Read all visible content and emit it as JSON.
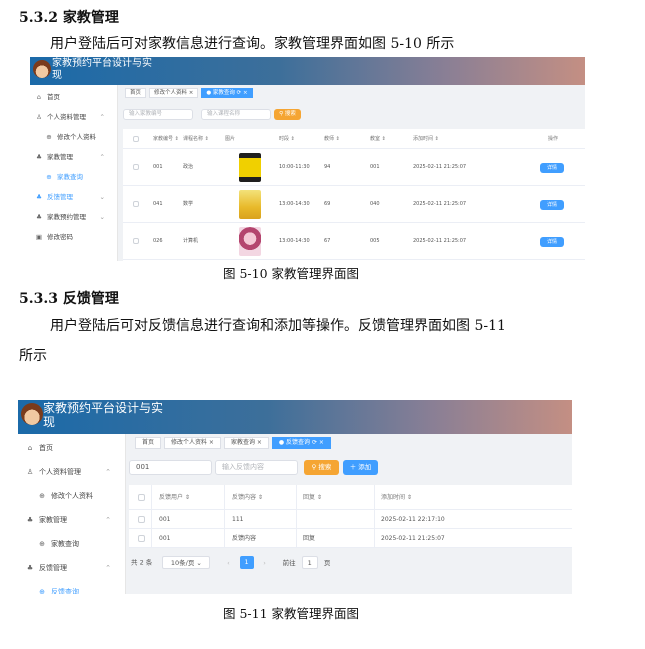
{
  "section_532": {
    "heading": "5.3.2 家教管理",
    "paragraph": "用户登陆后可对家教信息进行查询。家教管理界面如图 5-10 所示",
    "caption": "图 5-10 家教管理界面图"
  },
  "section_533": {
    "heading": "5.3.3 反馈管理",
    "paragraph_line1": "用户登陆后可对反馈信息进行查询和添加等操作。反馈管理界面如图 5-11",
    "paragraph_line2": "所示",
    "caption": "图 5-11 家教管理界面图"
  },
  "app_title_line1": "家教预约平台设计与实",
  "app_title_line2": "现",
  "figure1": {
    "sidebar": [
      {
        "icon": "⌂",
        "label": "首页"
      },
      {
        "icon": "♙",
        "label": "个人资料管理",
        "chevron": "⌃"
      },
      {
        "icon": "⊕",
        "label": "修改个人资料",
        "sub": true
      },
      {
        "icon": "♣",
        "label": "家教管理",
        "chevron": "⌃"
      },
      {
        "icon": "⊕",
        "label": "家教查询",
        "sub": true,
        "active": true
      },
      {
        "icon": "♣",
        "label": "反馈管理",
        "chevron": "⌄",
        "active": true
      },
      {
        "icon": "♣",
        "label": "家教预约管理",
        "chevron": "⌄"
      },
      {
        "icon": "▣",
        "label": "修改密码"
      }
    ],
    "tabs": [
      {
        "label": "首页"
      },
      {
        "label": "修改个人资料 ×"
      },
      {
        "label": "● 家教查询 ⟳ ×",
        "active": true
      }
    ],
    "search_placeholder_1": "输入家教编号",
    "search_placeholder_2": "输入课程名称",
    "search_button": "⚲ 搜索",
    "columns": [
      "家教编号 ⇕",
      "课程名称 ⇕",
      "图片",
      "时段 ⇕",
      "教师 ⇕",
      "教室 ⇕",
      "添加时间 ⇕",
      "操作"
    ],
    "rows": [
      {
        "id": "001",
        "course": "政治",
        "time": "10:00-11:30",
        "teacher": "94",
        "room": "001",
        "added": "2025-02-11 21:25:07",
        "action": "详情"
      },
      {
        "id": "041",
        "course": "数学",
        "time": "13:00-14:30",
        "teacher": "69",
        "room": "040",
        "added": "2025-02-11 21:25:07",
        "action": "详情"
      },
      {
        "id": "026",
        "course": "计算机",
        "time": "13:00-14:30",
        "teacher": "67",
        "room": "005",
        "added": "2025-02-11 21:25:07",
        "action": "详情"
      }
    ],
    "colors": {
      "accent": "#409eff",
      "search": "#f5a533"
    }
  },
  "figure2": {
    "sidebar": [
      {
        "icon": "⌂",
        "label": "首页"
      },
      {
        "icon": "♙",
        "label": "个人资料管理",
        "chevron": "⌃"
      },
      {
        "icon": "⊕",
        "label": "修改个人资料",
        "sub": true
      },
      {
        "icon": "♣",
        "label": "家教管理",
        "chevron": "⌃"
      },
      {
        "icon": "⊕",
        "label": "家教查询",
        "sub": true
      },
      {
        "icon": "♣",
        "label": "反馈管理",
        "chevron": "⌃"
      },
      {
        "icon": "⊕",
        "label": "反馈查询",
        "sub": true,
        "active": true
      }
    ],
    "tabs": [
      {
        "label": "首页"
      },
      {
        "label": "修改个人资料 ×"
      },
      {
        "label": "家教查询 ×"
      },
      {
        "label": "● 反馈查询 ⟳ ×",
        "active": true
      }
    ],
    "search_value": "001",
    "search_placeholder": "输入反馈内容",
    "search_button": "⚲ 搜索",
    "add_button": "＋ 添加",
    "columns": [
      "反馈用户 ⇕",
      "反馈内容 ⇕",
      "回复 ⇕",
      "添加时间 ⇕"
    ],
    "rows": [
      {
        "user": "001",
        "content": "111",
        "reply": "",
        "added": "2025-02-11 22:17:10"
      },
      {
        "user": "001",
        "content": "反馈内容",
        "reply": "回复",
        "added": "2025-02-11 21:25:07"
      }
    ],
    "pager": {
      "total": "共 2 条",
      "page_size": "10条/页 ⌄",
      "prev": "‹",
      "current": "1",
      "next": "›",
      "goto_label": "前往",
      "goto_value": "1",
      "page_unit": "页"
    }
  }
}
